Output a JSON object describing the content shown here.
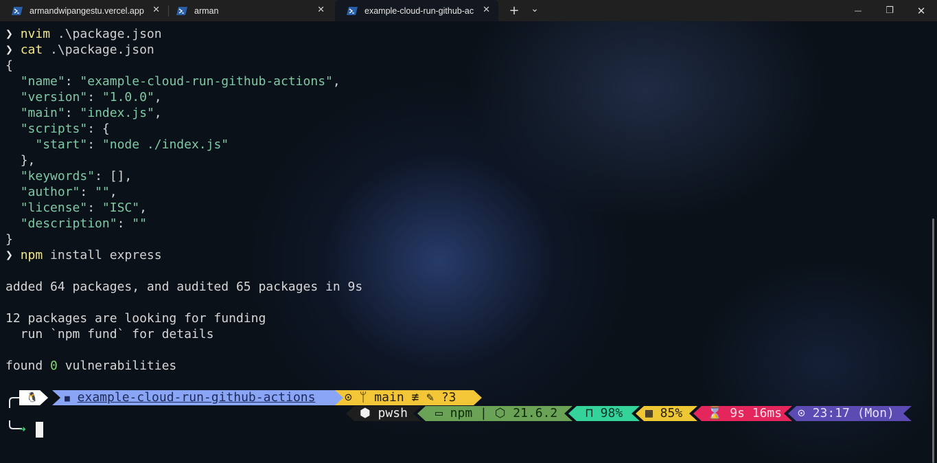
{
  "tabs": [
    {
      "label": "armandwipangestu.vercel.app",
      "icon": "powershell-icon",
      "active": false
    },
    {
      "label": "arman",
      "icon": "powershell-icon",
      "active": false
    },
    {
      "label": "example-cloud-run-github-ac",
      "icon": "powershell-icon",
      "active": true
    }
  ],
  "window_controls": {
    "new_tab": "+",
    "dropdown": "⌄",
    "minimize": "—",
    "maximize": "❐",
    "close": "✕"
  },
  "terminal": {
    "cmd1": {
      "command": "nvim",
      "args": " .\\package.json"
    },
    "cmd2": {
      "command": "cat",
      "args": " .\\package.json"
    },
    "json": {
      "open": "{",
      "name_key": "\"name\"",
      "name_val": "\"example-cloud-run-github-actions\"",
      "version_key": "\"version\"",
      "version_val": "\"1.0.0\"",
      "main_key": "\"main\"",
      "main_val": "\"index.js\"",
      "scripts_key": "\"scripts\"",
      "start_key": "\"start\"",
      "start_val": "\"node ./index.js\"",
      "scripts_close": "},",
      "keywords_key": "\"keywords\"",
      "keywords_val": "[],",
      "author_key": "\"author\"",
      "author_val": "\"\"",
      "license_key": "\"license\"",
      "license_val": "\"ISC\"",
      "description_key": "\"description\"",
      "description_val": "\"\"",
      "close": "}"
    },
    "cmd3": {
      "command": "npm",
      "args": " install express"
    },
    "output": {
      "added": "added 64 packages, and audited 65 packages in 9s",
      "funding": "12 packages are looking for funding",
      "fund_hint": "  run `npm fund` for details",
      "found_prefix": "found ",
      "found_count": "0",
      "found_suffix": " vulnerabilities"
    }
  },
  "prompt": {
    "os_icon": "🐧",
    "folder_icon": "■",
    "path": "example-cloud-run-github-actions",
    "git": "⊙ ᛘ main ≢ ✎ ?3",
    "shell": "⬢ pwsh",
    "npm": "▭ npm | ⬡ 21.6.2",
    "battery": "⊓ 98%",
    "memory": "▦ 85%",
    "duration": "⌛ 9s 16ms",
    "clock": "⊙ 23:17 (Mon)",
    "colors": {
      "os": "#ffffff",
      "path": "#8aa5f5",
      "git": "#f2c636",
      "shell": "#1e1e1e",
      "npm": "#6aa356",
      "battery": "#34d39a",
      "memory": "#eec834",
      "duration": "#e4265c",
      "clock": "#5b4bb3"
    }
  }
}
